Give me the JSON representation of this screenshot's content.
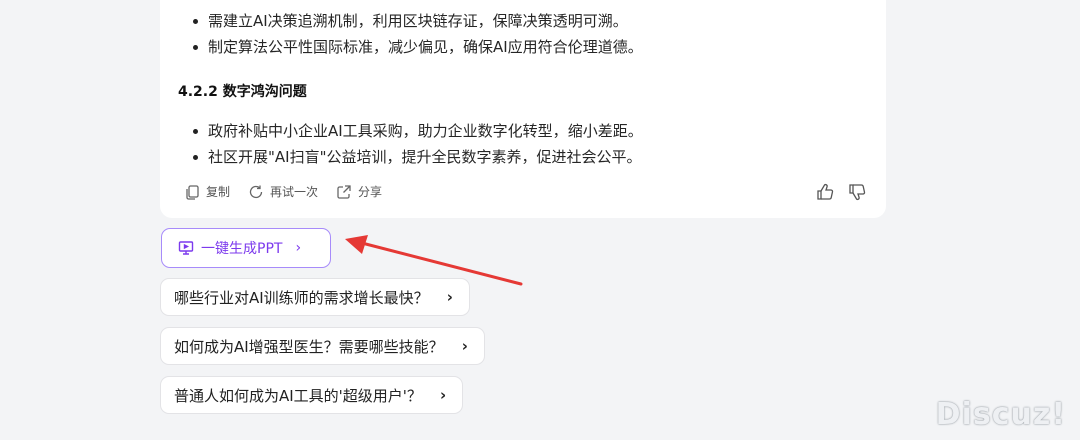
{
  "answer": {
    "bullets_top": [
      "需建立AI决策追溯机制，利用区块链存证，保障决策透明可溯。",
      "制定算法公平性国际标准，减少偏见，确保AI应用符合伦理道德。"
    ],
    "section_heading": "4.2.2 数字鸿沟问题",
    "bullets_bottom": [
      "政府补贴中小企业AI工具采购，助力企业数字化转型，缩小差距。",
      "社区开展\"AI扫盲\"公益培训，提升全民数字素养，促进社会公平。"
    ],
    "actions": {
      "copy": "复制",
      "retry": "再试一次",
      "share": "分享"
    }
  },
  "ppt_button": {
    "label": "一键生成PPT",
    "accent": "#7c3aed"
  },
  "suggestions": [
    "哪些行业对AI训练师的需求增长最快？",
    "如何成为AI增强型医生？需要哪些技能？",
    "普通人如何成为AI工具的'超级用户'？"
  ],
  "watermark": "Discuz!",
  "annotation_color": "#e53935"
}
